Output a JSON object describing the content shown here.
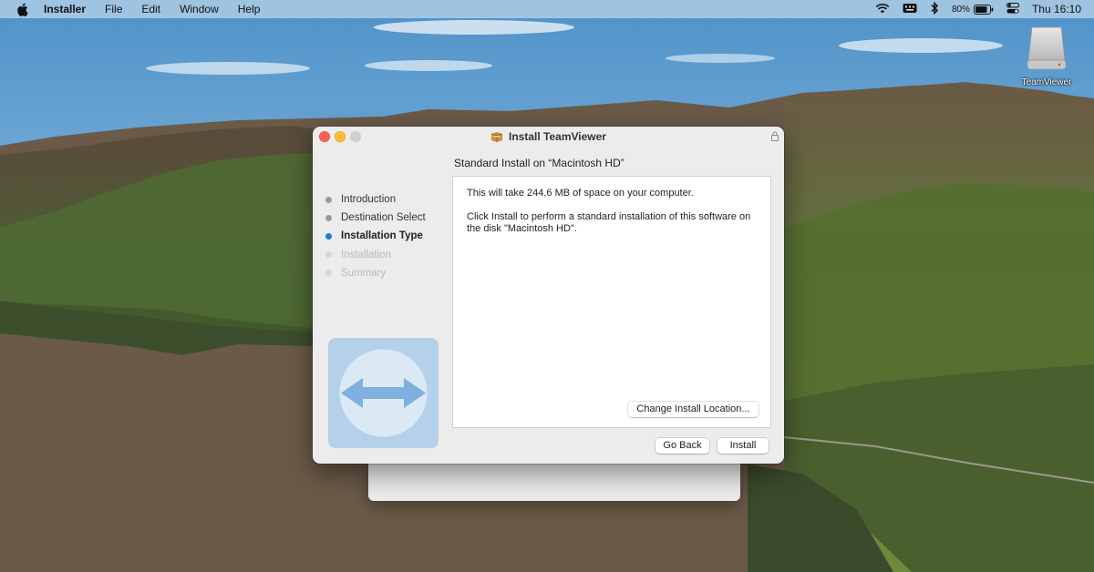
{
  "menubar": {
    "app_name": "Installer",
    "items": [
      "File",
      "Edit",
      "Window",
      "Help"
    ],
    "battery_percent": "80%",
    "clock": "Thu 16:10"
  },
  "desktop": {
    "disk_label": "TeamViewer"
  },
  "window": {
    "title": "Install TeamViewer",
    "heading": "Standard Install on “Macintosh HD”",
    "steps": [
      {
        "label": "Introduction",
        "state": "done"
      },
      {
        "label": "Destination Select",
        "state": "done"
      },
      {
        "label": "Installation Type",
        "state": "current"
      },
      {
        "label": "Installation",
        "state": "pending"
      },
      {
        "label": "Summary",
        "state": "pending"
      }
    ],
    "body": {
      "line1": "This will take 244,6 MB of space on your computer.",
      "line2": "Click Install to perform a standard installation of this software on the disk \"Macintosh HD\"."
    },
    "buttons": {
      "change_location": "Change Install Location...",
      "go_back": "Go Back",
      "install": "Install"
    }
  },
  "colors": {
    "close": "#fe5f57",
    "minimize": "#febc2e",
    "current_step": "#1f7ae0",
    "teamviewer_tile": "#b5d1ea"
  }
}
